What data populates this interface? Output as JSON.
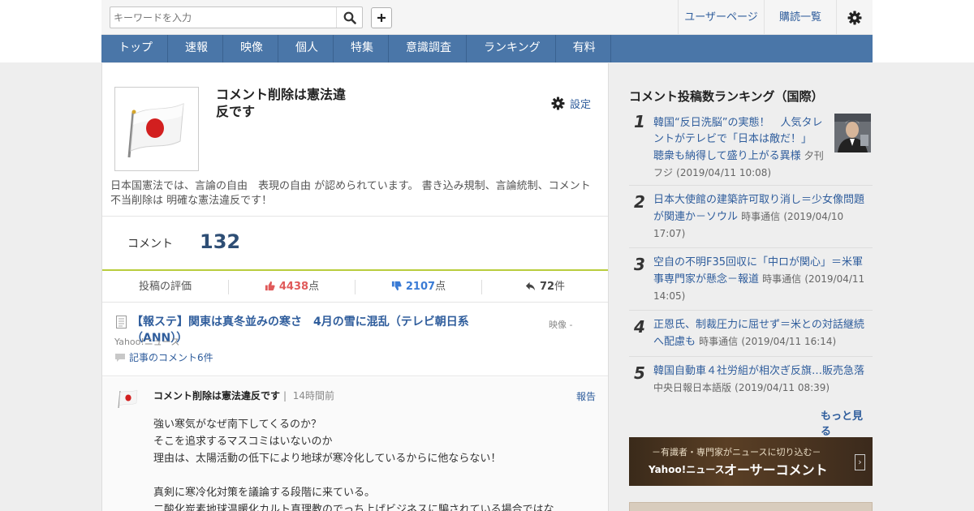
{
  "search": {
    "placeholder": "キーワードを入力"
  },
  "top_links": {
    "user_page": "ユーザーページ",
    "subscriptions": "購読一覧"
  },
  "nav": [
    "トップ",
    "速報",
    "映像",
    "個人",
    "特集",
    "意識調査",
    "ランキング",
    "有料"
  ],
  "profile": {
    "name": "コメント削除は憲法違反です",
    "settings_label": "設定",
    "description": "日本国憲法では、言論の自由　表現の自由 が認められています。 書き込み規制、言論統制、コメント不当削除は 明確な憲法違反です！"
  },
  "comments": {
    "label": "コメント",
    "count": "132"
  },
  "evaluation": {
    "label": "投稿の評価",
    "likes": "4438",
    "likes_unit": "点",
    "dislikes": "2107",
    "dislikes_unit": "点",
    "replies": "72",
    "replies_unit": "件"
  },
  "article": {
    "title": "【報ステ】関東は真冬並みの寒さ　4月の雪に混乱（テレビ朝日系（ANN））",
    "category": "映像 -",
    "source": "Yahoo!ニュース",
    "comment_link": "記事のコメント6件"
  },
  "comment": {
    "author": "コメント削除は憲法違反です",
    "separator": "|",
    "time": "14時間前",
    "report": "報告",
    "lines": [
      "強い寒気がなぜ南下してくるのか？",
      "そこを追求するマスコミはいないのか",
      "理由は、太陽活動の低下により地球が寒冷化しているからに他ならない！",
      "",
      "真剣に寒冷化対策を議論する段階に来ている。",
      "二酸化炭素地球温暖化カルト真理教のでっち上げビジネスに騙されている場合ではな"
    ]
  },
  "ranking": {
    "title": "コメント投稿数ランキング（国際）",
    "items": [
      {
        "num": "1",
        "title": "韓国“反日洗脳”の実態！　人気タレントがテレビで「日本は敵だ！」　聴衆も納得して盛り上がる異様",
        "source": "夕刊フジ",
        "date": "(2019/04/11 10:08)"
      },
      {
        "num": "2",
        "title": "日本大使館の建築許可取り消し＝少女像問題が関連か－ソウル",
        "source": "時事通信",
        "date": "(2019/04/10 17:07)"
      },
      {
        "num": "3",
        "title": "空自の不明F35回収に「中ロが関心」＝米軍事専門家が懸念－報道",
        "source": "時事通信",
        "date": "(2019/04/11 14:05)"
      },
      {
        "num": "4",
        "title": "正恩氏、制裁圧力に屈せず＝米との対話継続へ配慮も",
        "source": "時事通信",
        "date": "(2019/04/11 16:14)"
      },
      {
        "num": "5",
        "title": "韓国自動車４社労組が相次ぎ反旗…販売急落",
        "source": "中央日報日本語版",
        "date": "(2019/04/11 08:39)"
      }
    ],
    "more": "もっと見る"
  },
  "banner": {
    "line1": "－有識者・専門家がニュースに切り込む－",
    "line2a": "Yahoo!ニュース",
    "line2b": "オーサーコメント",
    "arrow": "›"
  },
  "colors": {
    "nav_bg": "#4a76a8",
    "link": "#2f5d9c",
    "accent_green": "#b9cd3c",
    "like_red": "#e05a5a",
    "dislike_blue": "#3a7bd5"
  }
}
